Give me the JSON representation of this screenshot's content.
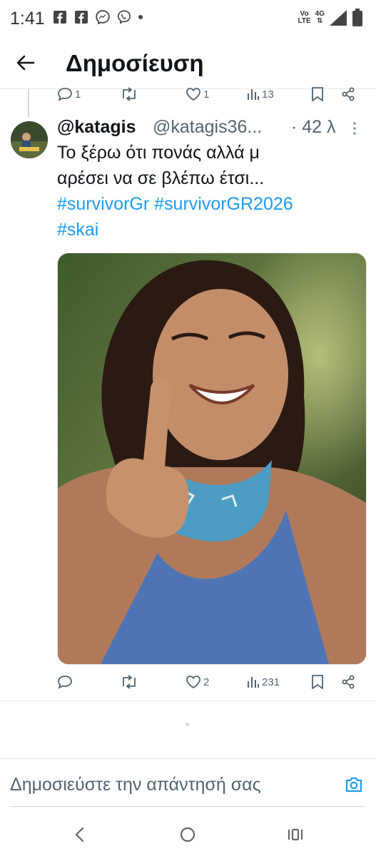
{
  "status_bar": {
    "time": "1:41",
    "net_top": "Vo",
    "net_bottom": "LTE",
    "signal_label": "4G",
    "notification_icons": [
      "facebook-icon",
      "facebook-icon",
      "messenger-icon",
      "viber-icon"
    ]
  },
  "header": {
    "title": "Δημοσίευση"
  },
  "previous_tweet": {
    "reply_count": "1",
    "like_count": "1",
    "view_count": "13"
  },
  "tweet": {
    "display_name": "@katagis",
    "handle": "@katagis36...",
    "time": "· 42 λ",
    "text_line1": "Το ξέρω ότι πονάς αλλά μ",
    "text_line2": "αρέσει να σε βλέπω έτσι...",
    "hashtag1": "#survivorGr",
    "hashtag2": "#survivorGR2026",
    "hashtag3": "#skai",
    "reply_count": "",
    "retweet_count": "",
    "like_count": "2",
    "view_count": "231"
  },
  "reply_bar": {
    "placeholder": "Δημοσιεύστε την απάντησή σας"
  },
  "colors": {
    "accent": "#1d9bf0",
    "text": "#0f1419",
    "muted": "#536471"
  }
}
